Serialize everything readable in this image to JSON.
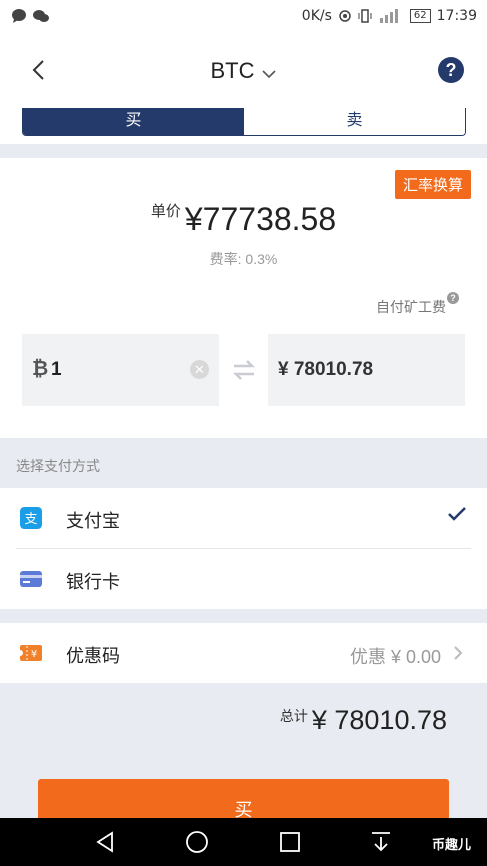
{
  "status_bar": {
    "net_speed": "0K/s",
    "battery": "62",
    "time": "17:39"
  },
  "header": {
    "title": "BTC"
  },
  "tabs": {
    "buy": "买",
    "sell": "卖"
  },
  "quote": {
    "rate_button": "汇率换算",
    "price_label": "单价",
    "price": "¥77738.58",
    "fee": "费率: 0.3%",
    "miner_fee": "自付矿工费"
  },
  "convert": {
    "coin_symbol": "₿",
    "btc_amount": "1",
    "cny_amount": "¥ 78010.78"
  },
  "payment": {
    "section_label": "选择支付方式",
    "alipay": "支付宝",
    "bank_card": "银行卡"
  },
  "coupon": {
    "label": "优惠码",
    "value": "优惠 ¥ 0.00"
  },
  "total": {
    "label": "总计",
    "value": "¥ 78010.78"
  },
  "buy_button": "买",
  "watermark": "币趣儿",
  "colors": {
    "primary": "#233a6b",
    "accent": "#f26b1d",
    "alipay": "#1a9ee8",
    "bank": "#5b7bd6"
  }
}
